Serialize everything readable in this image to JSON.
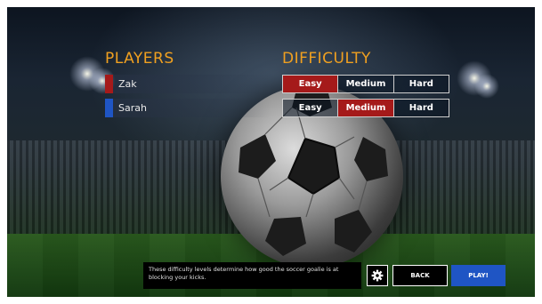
{
  "players": {
    "heading": "PLAYERS",
    "list": [
      {
        "name": "Zak",
        "color": "#a51a1a"
      },
      {
        "name": "Sarah",
        "color": "#1f55c4"
      }
    ]
  },
  "difficulty": {
    "heading": "DIFFICULTY",
    "options": [
      "Easy",
      "Medium",
      "Hard"
    ],
    "selected": [
      "Easy",
      "Medium"
    ]
  },
  "footer": {
    "info_text": "These difficulty levels determine how good the soccer goalie is at blocking your kicks.",
    "settings_icon": "gear-icon",
    "back_label": "BACK",
    "play_label": "PLAY!"
  },
  "colors": {
    "heading": "#f0a020",
    "selected": "#a51a1a",
    "play": "#1f55c4"
  }
}
